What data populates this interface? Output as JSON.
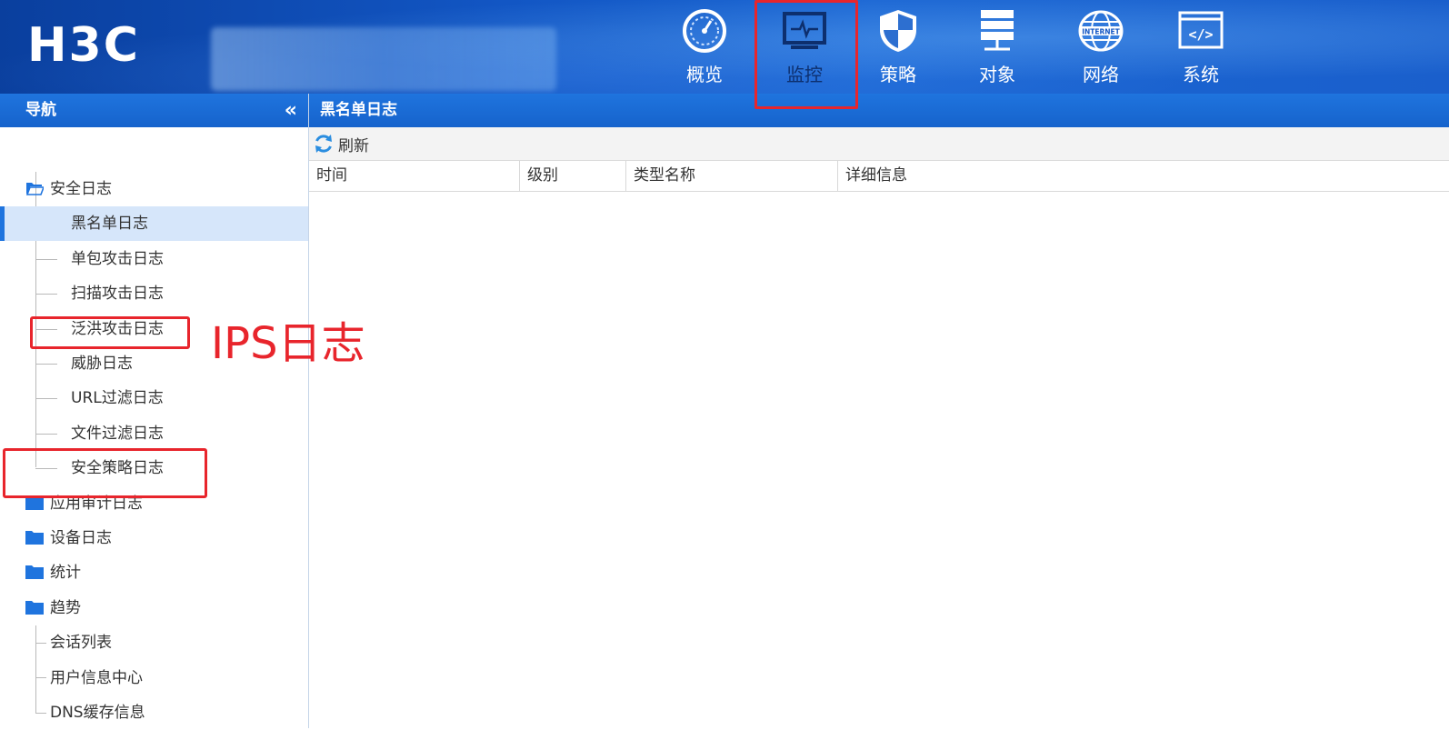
{
  "header": {
    "logo": "H3C",
    "tabs": [
      {
        "label": "概览",
        "icon": "gauge-icon"
      },
      {
        "label": "监控",
        "icon": "monitor-icon",
        "active": true
      },
      {
        "label": "策略",
        "icon": "shield-icon"
      },
      {
        "label": "对象",
        "icon": "server-stack-icon"
      },
      {
        "label": "网络",
        "icon": "internet-globe-icon"
      },
      {
        "label": "系统",
        "icon": "code-window-icon"
      }
    ]
  },
  "sidebar": {
    "title": "导航",
    "collapse_glyph": "«",
    "items": [
      {
        "label": "安全日志",
        "type": "folder-open"
      },
      {
        "label": "黑名单日志",
        "type": "leaf",
        "selected": true
      },
      {
        "label": "单包攻击日志",
        "type": "leaf"
      },
      {
        "label": "扫描攻击日志",
        "type": "leaf"
      },
      {
        "label": "泛洪攻击日志",
        "type": "leaf"
      },
      {
        "label": "威胁日志",
        "type": "leaf"
      },
      {
        "label": "URL过滤日志",
        "type": "leaf"
      },
      {
        "label": "文件过滤日志",
        "type": "leaf"
      },
      {
        "label": "安全策略日志",
        "type": "leaf"
      },
      {
        "label": "应用审计日志",
        "type": "folder"
      },
      {
        "label": "设备日志",
        "type": "folder"
      },
      {
        "label": "统计",
        "type": "folder"
      },
      {
        "label": "趋势",
        "type": "folder"
      },
      {
        "label": "会话列表",
        "type": "leaf"
      },
      {
        "label": "用户信息中心",
        "type": "leaf"
      },
      {
        "label": "DNS缓存信息",
        "type": "leaf"
      }
    ]
  },
  "main": {
    "title": "黑名单日志",
    "refresh_label": "刷新",
    "columns": [
      "时间",
      "级别",
      "类型名称",
      "详细信息"
    ]
  },
  "annotation": {
    "text": "IPS日志",
    "color": "#e8252c"
  },
  "colors": {
    "header_blue": "#1256c4",
    "panel_blue": "#1f74de",
    "selected_row": "#d6e6fa",
    "annotation_red": "#e8252c"
  }
}
